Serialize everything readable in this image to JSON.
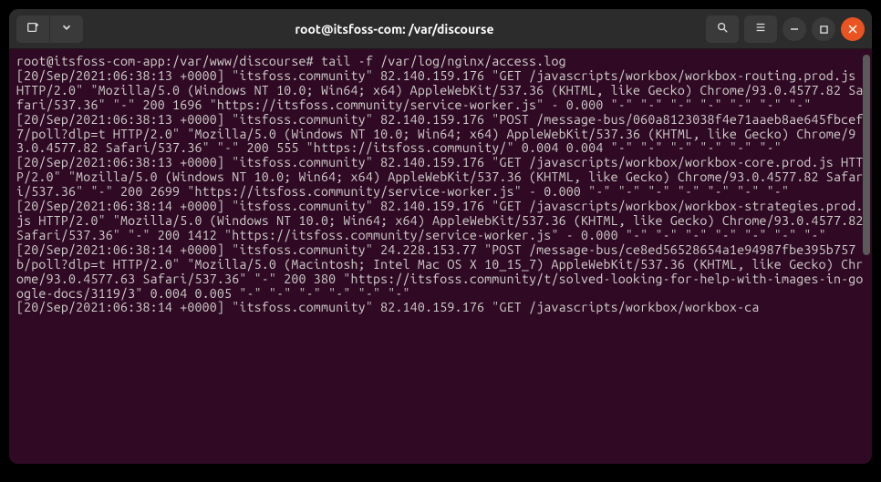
{
  "window": {
    "title": "root@itsfoss-com: /var/discourse"
  },
  "terminal": {
    "prompt": "root@itsfoss-com-app:/var/www/discourse# ",
    "command": "tail -f /var/log/nginx/access.log",
    "lines": [
      "[20/Sep/2021:06:38:13 +0000] \"itsfoss.community\" 82.140.159.176 \"GET /javascripts/workbox/workbox-routing.prod.js HTTP/2.0\" \"Mozilla/5.0 (Windows NT 10.0; Win64; x64) AppleWebKit/537.36 (KHTML, like Gecko) Chrome/93.0.4577.82 Safari/537.36\" \"-\" 200 1696 \"https://itsfoss.community/service-worker.js\" - 0.000 \"-\" \"-\" \"-\" \"-\" \"-\" \"-\" \"-\"",
      "[20/Sep/2021:06:38:13 +0000] \"itsfoss.community\" 82.140.159.176 \"POST /message-bus/060a8123038f4e71aaeb8ae645fbcef7/poll?dlp=t HTTP/2.0\" \"Mozilla/5.0 (Windows NT 10.0; Win64; x64) AppleWebKit/537.36 (KHTML, like Gecko) Chrome/93.0.4577.82 Safari/537.36\" \"-\" 200 555 \"https://itsfoss.community/\" 0.004 0.004 \"-\" \"-\" \"-\" \"-\" \"-\" \"-\"",
      "[20/Sep/2021:06:38:13 +0000] \"itsfoss.community\" 82.140.159.176 \"GET /javascripts/workbox/workbox-core.prod.js HTTP/2.0\" \"Mozilla/5.0 (Windows NT 10.0; Win64; x64) AppleWebKit/537.36 (KHTML, like Gecko) Chrome/93.0.4577.82 Safari/537.36\" \"-\" 200 2699 \"https://itsfoss.community/service-worker.js\" - 0.000 \"-\" \"-\" \"-\" \"-\" \"-\" \"-\" \"-\"",
      "[20/Sep/2021:06:38:14 +0000] \"itsfoss.community\" 82.140.159.176 \"GET /javascripts/workbox/workbox-strategies.prod.js HTTP/2.0\" \"Mozilla/5.0 (Windows NT 10.0; Win64; x64) AppleWebKit/537.36 (KHTML, like Gecko) Chrome/93.0.4577.82 Safari/537.36\" \"-\" 200 1412 \"https://itsfoss.community/service-worker.js\" - 0.000 \"-\" \"-\" \"-\" \"-\" \"-\" \"-\" \"-\"",
      "[20/Sep/2021:06:38:14 +0000] \"itsfoss.community\" 24.228.153.77 \"POST /message-bus/ce8ed56528654a1e94987fbe395b757b/poll?dlp=t HTTP/2.0\" \"Mozilla/5.0 (Macintosh; Intel Mac OS X 10_15_7) AppleWebKit/537.36 (KHTML, like Gecko) Chrome/93.0.4577.63 Safari/537.36\" \"-\" 200 380 \"https://itsfoss.community/t/solved-looking-for-help-with-images-in-google-docs/3119/3\" 0.004 0.005 \"-\" \"-\" \"-\" \"-\" \"-\" \"-\"",
      "[20/Sep/2021:06:38:14 +0000] \"itsfoss.community\" 82.140.159.176 \"GET /javascripts/workbox/workbox-ca"
    ]
  }
}
